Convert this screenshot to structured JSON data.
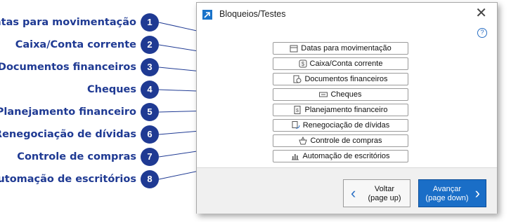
{
  "window": {
    "title": "Bloqueios/Testes",
    "close_glyph": "✕",
    "help_glyph": "?"
  },
  "callouts": [
    {
      "label": "Datas para movimentação",
      "number": "1"
    },
    {
      "label": "Caixa/Conta corrente",
      "number": "2"
    },
    {
      "label": "Documentos financeiros",
      "number": "3"
    },
    {
      "label": "Cheques",
      "number": "4"
    },
    {
      "label": "Planejamento financeiro",
      "number": "5"
    },
    {
      "label": "Renegociação de dívidas",
      "number": "6"
    },
    {
      "label": "Controle de compras",
      "number": "7"
    },
    {
      "label": "Automação de escritórios",
      "number": "8"
    }
  ],
  "options": [
    {
      "label": "Datas para movimentação",
      "icon": "calendar-icon"
    },
    {
      "label": "Caixa/Conta corrente",
      "icon": "cash-box-icon"
    },
    {
      "label": "Documentos financeiros",
      "icon": "documents-icon"
    },
    {
      "label": "Cheques",
      "icon": "check-icon"
    },
    {
      "label": "Planejamento financeiro",
      "icon": "planning-icon"
    },
    {
      "label": "Renegociação de dívidas",
      "icon": "renegotiation-icon"
    },
    {
      "label": "Controle de compras",
      "icon": "basket-icon"
    },
    {
      "label": "Automação de escritórios",
      "icon": "bar-chart-icon"
    }
  ],
  "footer": {
    "back_line1": "Voltar",
    "back_line2": "(page up)",
    "next_line1": "Avançar",
    "next_line2": "(page down)"
  },
  "colors": {
    "callout": "#1f3a93",
    "accent": "#1a6ec7"
  }
}
